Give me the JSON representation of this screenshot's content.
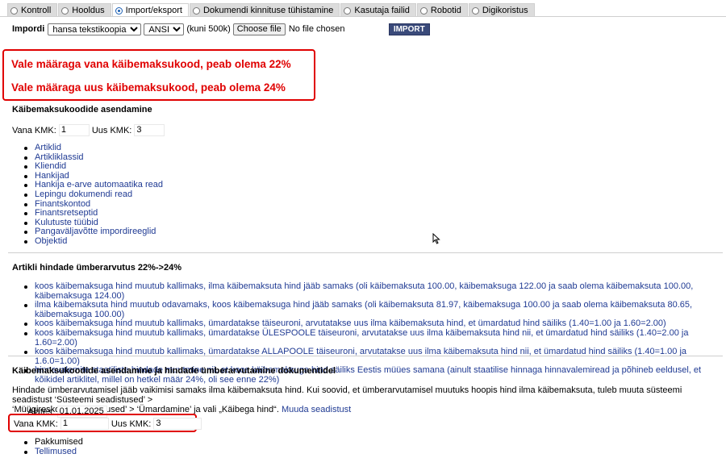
{
  "tabs": [
    {
      "label": "Kontroll",
      "active": false
    },
    {
      "label": "Hooldus",
      "active": false
    },
    {
      "label": "Import/eksport",
      "active": true
    },
    {
      "label": "Dokumendi kinnituse tühistamine",
      "active": false
    },
    {
      "label": "Kasutaja failid",
      "active": false
    },
    {
      "label": "Robotid",
      "active": false
    },
    {
      "label": "Digikoristus",
      "active": false
    }
  ],
  "import": {
    "label": "Impordi",
    "type_value": "hansa tekstikoopia",
    "encoding_value": "ANSI",
    "limit_text": "(kuni 500k)",
    "choose_file_label": "Choose file",
    "no_file_text": "No file chosen",
    "import_button": "IMPORT"
  },
  "warnings": [
    "Vale määraga vana käibemaksukood, peab olema 22%",
    "Vale määraga uus käibemaksukood, peab olema 24%"
  ],
  "replace": {
    "title": "Käibemaksukoodide asendamine",
    "old_label": "Vana KMK:",
    "old_value": "1",
    "new_label": "Uus KMK:",
    "new_value": "3",
    "links": [
      "Artiklid",
      "Artikliklassid",
      "Kliendid",
      "Hankijad",
      "Hankija e-arve automaatika read",
      "Lepingu dokumendi read",
      "Finantskontod",
      "Finantsretseptid",
      "Kulutuste tüübid",
      "Pangaväljavõtte impordireeglid",
      "Objektid"
    ]
  },
  "recalc": {
    "title": "Artikli hindade ümberarvutus 22%->24%",
    "items": [
      "koos käibemaksuga hind muutub kallimaks, ilma käibemaksuta hind jääb samaks (oli käibemaksuta 100.00, käibemaksuga 122.00 ja saab olema käibemaksuta 100.00, käibemaksuga 124.00)",
      "ilma käibemaksuta hind muutub odavamaks, koos käibemaksuga hind jääb samaks (oli käibemaksuta 81.97, käibemaksuga 100.00 ja saab olema käibemaksuta 80.65, käibemaksuga 100.00)",
      "koos käibemaksuga hind muutub kallimaks, ümardatakse täiseuroni, arvutatakse uus ilma käibemaksuta hind, et ümardatud hind säiliks (1.40=1.00 ja 1.60=2.00)",
      "koos käibemaksuga hind muutub kallimaks, ümardatakse ÜLESPOOLE täiseuroni, arvutatakse uus ilma käibemaksuta hind nii, et ümardatud hind säiliks (1.40=2.00 ja 1.60=2.00)",
      "koos käibemaksuga hind muutub kallimaks, ümardatakse ALLAPOOLE täiseuroni, arvutatakse uus ilma käibemaksuta hind nii, et ümardatud hind säiliks (1.40=1.00 ja 1.6.0=1.00)",
      "hinnavalemite staatiliste hindade muutmine nii, et koos käibemaksuga hind säiliks Eestis müües samana (ainult staatilise hinnaga hinnavalemiread ja põhineb eeldusel, et kõikidel artiklitel, millel on hetkel määr 24%, oli see enne 22%)"
    ]
  },
  "docs": {
    "title": "Käibemaksukoodide asendamine ja hindade ümberarvutamine dokumentidel",
    "para_1": "Hindade ümberarvutamisel jääb vaikimisi samaks ilma käibemaksuta hind. Kui soovid, et ümberarvutamisel muutuks hoopis hind ilma käibemaksuta, tuleb muuta süsteemi seadistust ‘Süsteemi seadistused’ >",
    "para_2": "‘Müügireskontro seadistused’ > ‘Ümardamine’ ja vali „Käibega hind“.",
    "settings_link": "Muuda seadistust",
    "from_label": "Alates:",
    "from_value": "01.01.2025",
    "old_label": "Vana KMK:",
    "old_value": "1",
    "new_label": "Uus KMK:",
    "new_value": "3",
    "items": [
      "Pakkumised",
      "Tellimused"
    ]
  }
}
